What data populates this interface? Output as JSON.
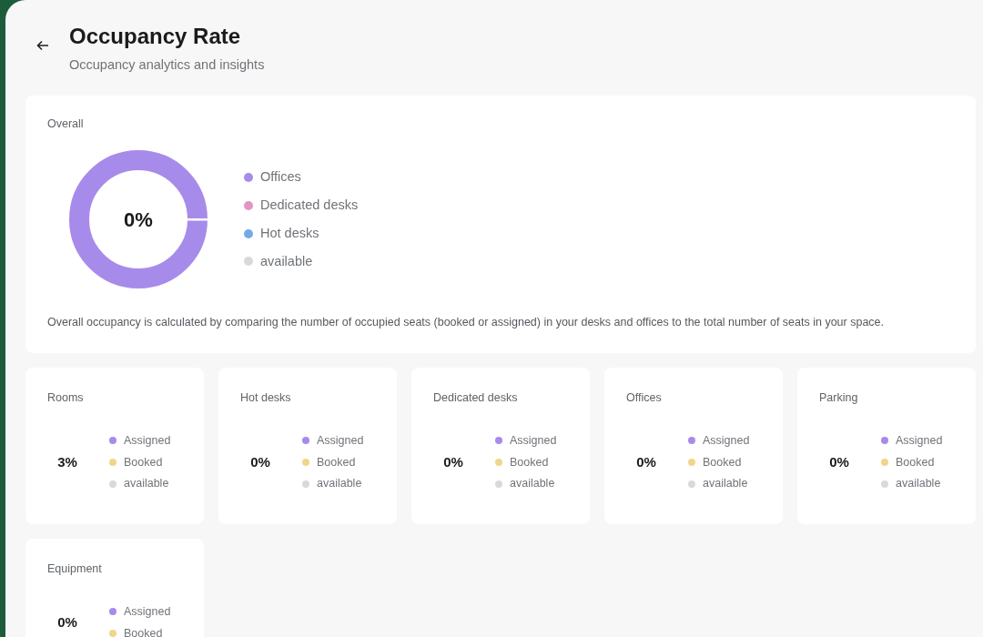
{
  "header": {
    "title": "Occupancy Rate",
    "subtitle": "Occupancy analytics and insights"
  },
  "overall": {
    "label": "Overall",
    "center_value": "0%",
    "legend": [
      {
        "label": "Offices",
        "color": "#a78bea"
      },
      {
        "label": "Dedicated desks",
        "color": "#e295c7"
      },
      {
        "label": "Hot desks",
        "color": "#72abe3"
      },
      {
        "label": "available",
        "color": "#d9d9d9"
      }
    ],
    "note": "Overall occupancy is calculated by comparing the number of occupied seats (booked or assigned) in your desks and offices to the total number of seats in your space."
  },
  "categories": [
    {
      "label": "Rooms",
      "value": "3%",
      "legend": [
        {
          "label": "Assigned",
          "color": "#a78bea"
        },
        {
          "label": "Booked",
          "color": "#f0d68a"
        },
        {
          "label": "available",
          "color": "#d9d9d9"
        }
      ]
    },
    {
      "label": "Hot desks",
      "value": "0%",
      "legend": [
        {
          "label": "Assigned",
          "color": "#a78bea"
        },
        {
          "label": "Booked",
          "color": "#f0d68a"
        },
        {
          "label": "available",
          "color": "#d9d9d9"
        }
      ]
    },
    {
      "label": "Dedicated desks",
      "value": "0%",
      "legend": [
        {
          "label": "Assigned",
          "color": "#a78bea"
        },
        {
          "label": "Booked",
          "color": "#f0d68a"
        },
        {
          "label": "available",
          "color": "#d9d9d9"
        }
      ]
    },
    {
      "label": "Offices",
      "value": "0%",
      "legend": [
        {
          "label": "Assigned",
          "color": "#a78bea"
        },
        {
          "label": "Booked",
          "color": "#f0d68a"
        },
        {
          "label": "available",
          "color": "#d9d9d9"
        }
      ]
    },
    {
      "label": "Parking",
      "value": "0%",
      "legend": [
        {
          "label": "Assigned",
          "color": "#a78bea"
        },
        {
          "label": "Booked",
          "color": "#f0d68a"
        },
        {
          "label": "available",
          "color": "#d9d9d9"
        }
      ]
    },
    {
      "label": "Equipment",
      "value": "0%",
      "legend": [
        {
          "label": "Assigned",
          "color": "#a78bea"
        },
        {
          "label": "Booked",
          "color": "#f0d68a"
        }
      ]
    }
  ]
}
